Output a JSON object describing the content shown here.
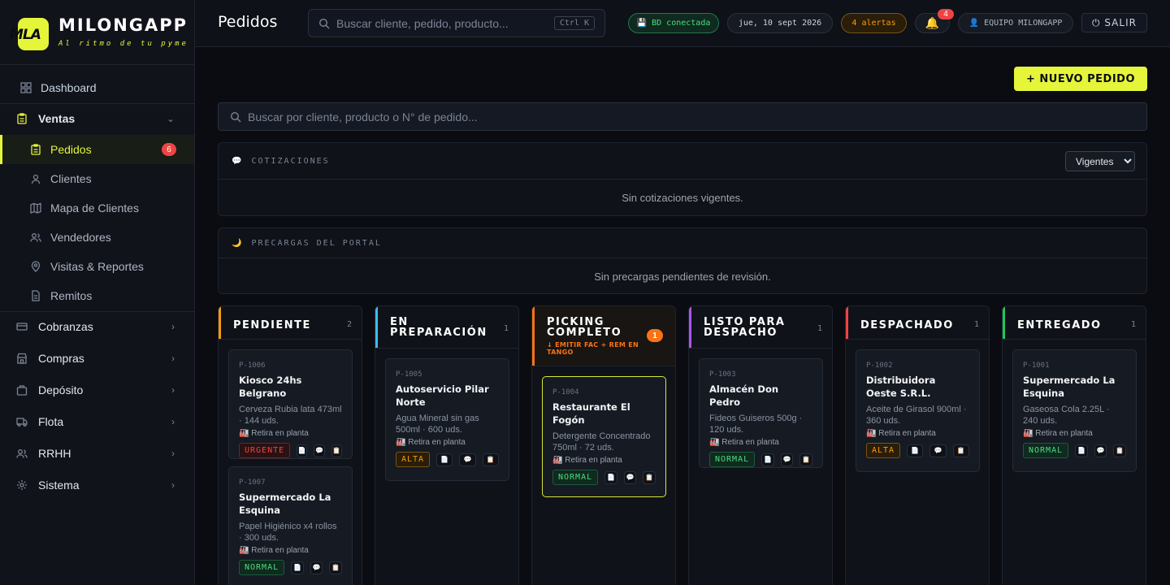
{
  "brand": {
    "name": "MILONGAPP",
    "tagline": "Al ritmo de tu pyme",
    "logo_text": "MLA"
  },
  "sidebar": {
    "items": [
      {
        "label": "Dashboard",
        "icon": "grid-icon"
      },
      {
        "label": "Ventas",
        "icon": "clipboard-icon"
      },
      {
        "label": "Pedidos",
        "icon": "clipboard-icon",
        "count": "6"
      },
      {
        "label": "Clientes",
        "icon": "user-icon"
      },
      {
        "label": "Mapa de Clientes",
        "icon": "map-icon"
      },
      {
        "label": "Vendedores",
        "icon": "users-icon"
      },
      {
        "label": "Visitas & Reportes",
        "icon": "pin-icon"
      },
      {
        "label": "Remitos",
        "icon": "document-icon"
      },
      {
        "label": "Cobranzas",
        "icon": "card-icon"
      },
      {
        "label": "Compras",
        "icon": "store-icon"
      },
      {
        "label": "Depósito",
        "icon": "box-icon"
      },
      {
        "label": "Flota",
        "icon": "truck-icon"
      },
      {
        "label": "RRHH",
        "icon": "people-icon"
      },
      {
        "label": "Sistema",
        "icon": "gear-icon"
      }
    ]
  },
  "topbar": {
    "title": "Pedidos",
    "search_placeholder": "Buscar cliente, pedido, producto...",
    "search_shortcut": "Ctrl K",
    "db_status": "💾 BD conectada",
    "date": "jue, 10 sept 2026",
    "alerts": "4 alertas",
    "bell": "🔔",
    "notifications": "4",
    "team": "👤 EQUIPO MILONGAPP",
    "exit": "⏻ SALIR"
  },
  "main": {
    "new_order": "+ NUEVO PEDIDO",
    "search_placeholder": "Buscar por cliente, producto o N° de pedido...",
    "cotizaciones": {
      "icon": "💬",
      "title": "COTIZACIONES",
      "filter": "Vigentes",
      "empty": "Sin cotizaciones vigentes."
    },
    "precargas": {
      "icon": "🌙",
      "title": "PRECARGAS DEL PORTAL",
      "empty": "Sin precargas pendientes de revisión."
    }
  },
  "kanban": {
    "pickup_label": "🏭 Retira en planta",
    "action_icons": [
      "📄",
      "💬",
      "📋"
    ],
    "columns": [
      {
        "title": "PENDIENTE",
        "count": "2",
        "color": "#f59e0b",
        "cards": [
          {
            "code": "P-1006",
            "client": "Kiosco 24hs Belgrano",
            "desc": "Cerveza Rubia lata 473ml · 144 uds.",
            "priority": "URGENTE"
          },
          {
            "code": "P-1007",
            "client": "Supermercado La Esquina",
            "desc": "Papel Higiénico x4 rollos · 300 uds.",
            "priority": "NORMAL"
          }
        ]
      },
      {
        "title": "EN PREPARACIÓN",
        "count": "1",
        "color": "#38bdf8",
        "cards": [
          {
            "code": "P-1005",
            "client": "Autoservicio Pilar Norte",
            "desc": "Agua Mineral sin gas 500ml · 600 uds.",
            "priority": "ALTA"
          }
        ]
      },
      {
        "title": "PICKING COMPLETO",
        "count": "1",
        "color": "#f97316",
        "warning": "↓ EMITIR FAC + REM EN TANGO",
        "cards": [
          {
            "code": "P-1004",
            "client": "Restaurante El Fogón",
            "desc": "Detergente Concentrado 750ml · 72 uds.",
            "priority": "NORMAL"
          }
        ]
      },
      {
        "title": "LISTO PARA DESPACHO",
        "count": "1",
        "color": "#a855f7",
        "cards": [
          {
            "code": "P-1003",
            "client": "Almacén Don Pedro",
            "desc": "Fideos Guiseros 500g · 120 uds.",
            "priority": "NORMAL"
          }
        ]
      },
      {
        "title": "DESPACHADO",
        "count": "1",
        "color": "#ef4444",
        "cards": [
          {
            "code": "P-1002",
            "client": "Distribuidora Oeste S.R.L.",
            "desc": "Aceite de Girasol 900ml · 360 uds.",
            "priority": "ALTA"
          }
        ]
      },
      {
        "title": "ENTREGADO",
        "count": "1",
        "color": "#22c55e",
        "cards": [
          {
            "code": "P-1001",
            "client": "Supermercado La Esquina",
            "desc": "Gaseosa Cola 2.25L · 240 uds.",
            "priority": "NORMAL"
          }
        ]
      }
    ]
  }
}
